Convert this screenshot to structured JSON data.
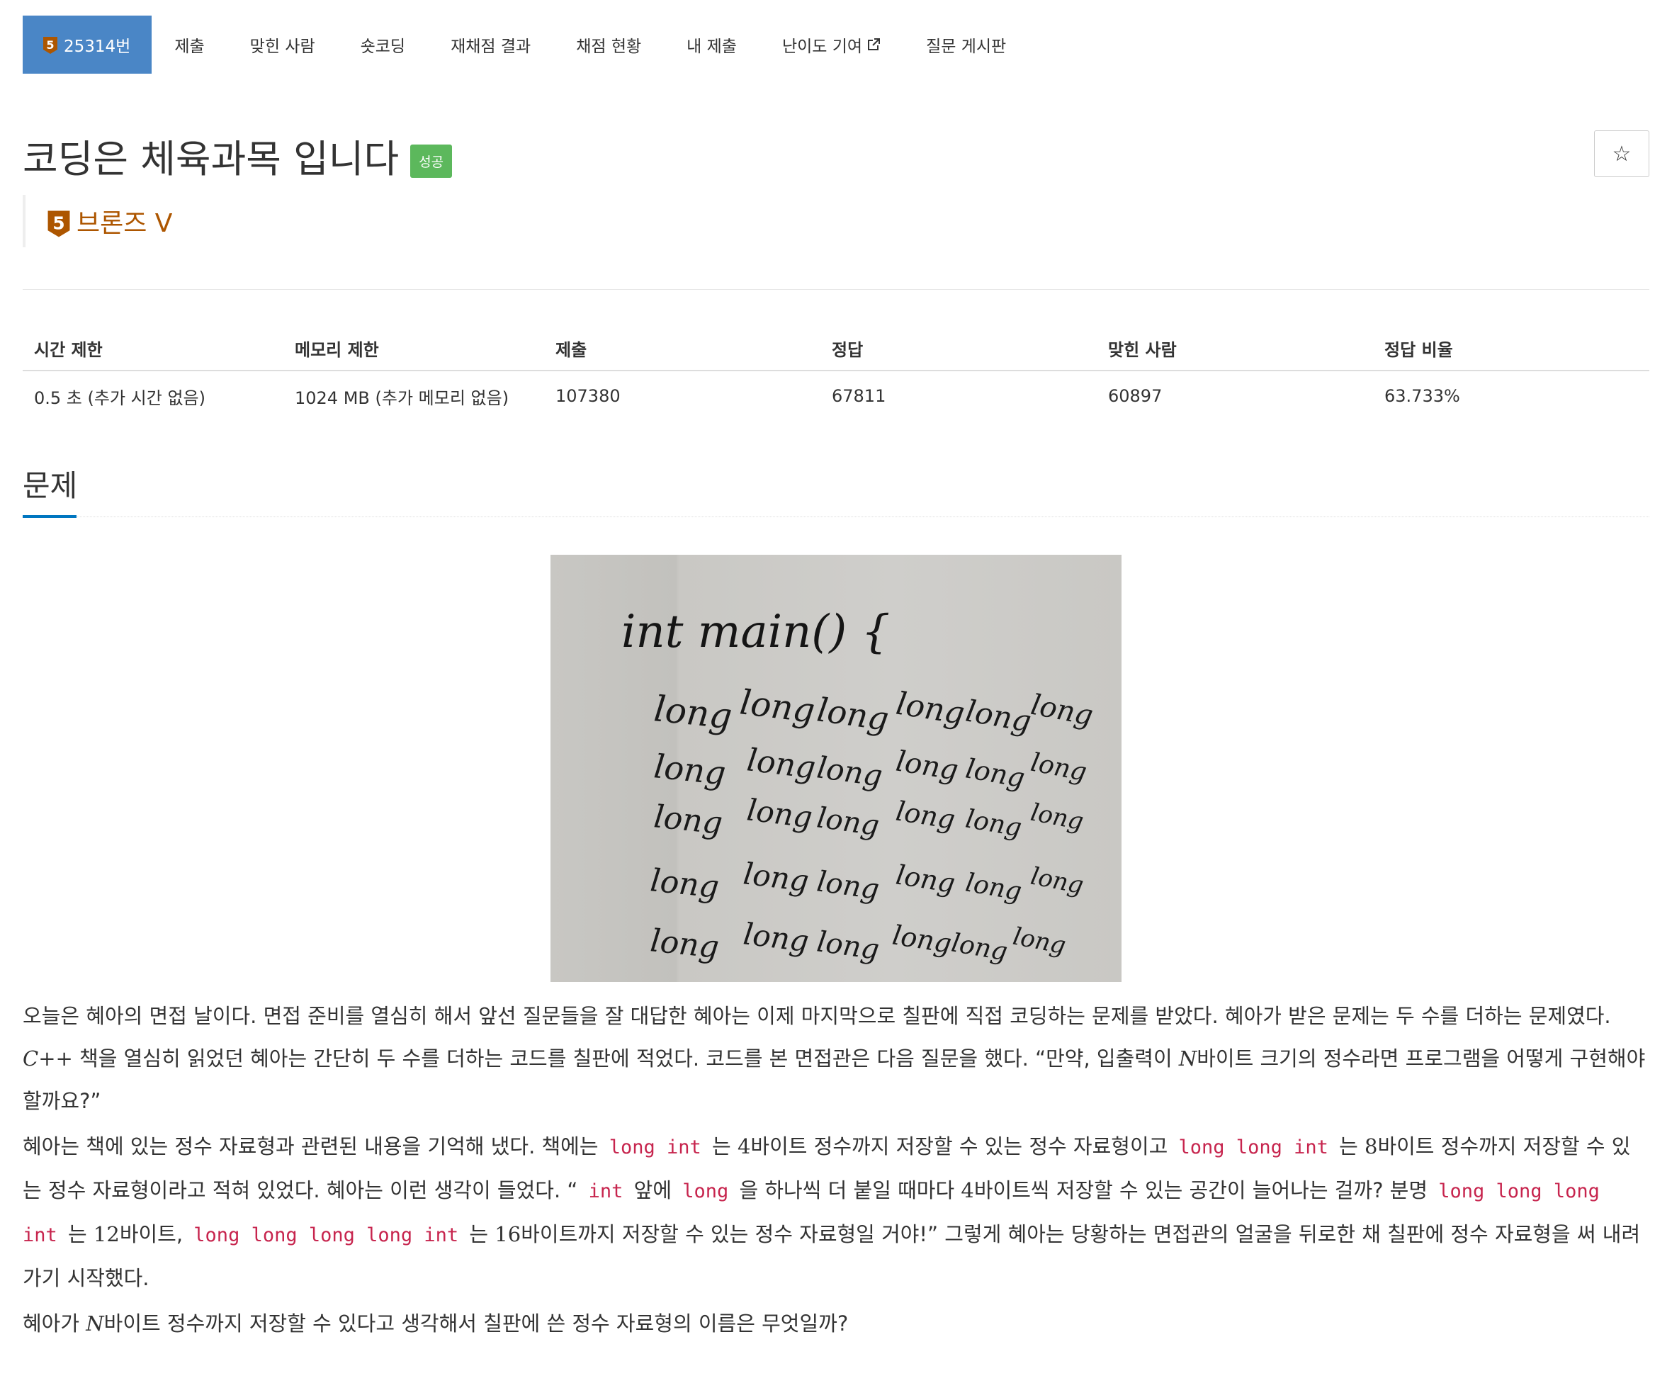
{
  "nav": {
    "problem_id": "25314번",
    "tabs": [
      "제출",
      "맞힌 사람",
      "숏코딩",
      "재채점 결과",
      "채점 현황",
      "내 제출",
      "난이도 기여",
      "질문 게시판"
    ]
  },
  "header": {
    "title": "코딩은 체육과목 입니다",
    "status_badge": "성공",
    "star_icon": "☆",
    "tier_digit": "5",
    "tier_label": "브론즈 V"
  },
  "stats": {
    "headers": [
      "시간 제한",
      "메모리 제한",
      "제출",
      "정답",
      "맞힌 사람",
      "정답 비율"
    ],
    "values": [
      "0.5 초 (추가 시간 없음)",
      "1024 MB (추가 메모리 없음)",
      "107380",
      "67811",
      "60897",
      "63.733%"
    ]
  },
  "section": {
    "title": "문제"
  },
  "board": {
    "line1": "int  main() {",
    "word": "long"
  },
  "problem": {
    "p1": {
      "a": "오늘은 혜아의 면접 날이다. 면접 준비를 열심히 해서 앞선 질문들을 잘 대답한 혜아는 이제 마지막으로 칠판에 직접 코딩하는 문제를 받았다. 혜아가 받은 문제는 두 수를 더하는 문제였다. ",
      "cpp": "C++",
      "b": " 책을 열심히 읽었던 혜아는 간단히 두 수를 더하는 코드를 칠판에 적었다. 코드를 본 면접관은 다음 질문을 했다. “만약, 입출력이 ",
      "n": "N",
      "c": "바이트 크기의 정수라면 프로그램을 어떻게 구현해야 할까요?”"
    },
    "p2": {
      "a": "혜아는 책에 있는 정수 자료형과 관련된 내용을 기억해 냈다. 책에는 ",
      "code1": "long int",
      "b": " 는 ",
      "n4": "4",
      "c": "바이트 정수까지 저장할 수 있는 정수 자료형이고 ",
      "code2": "long long int",
      "d": " 는 ",
      "n8": "8",
      "e": "바이트 정수까지 저장할 수 있는 정수 자료형이라고 적혀 있었다. 혜아는 이런 생각이 들었다. “ ",
      "code3": "int",
      "f": " 앞에 ",
      "code4": "long",
      "g": " 을 하나씩 더 붙일 때마다 ",
      "n4b": "4",
      "h": "바이트씩 저장할 수 있는 공간이 늘어나는 걸까? 분명 ",
      "code5": "long long long int",
      "i": " 는 ",
      "n12": "12",
      "j": "바이트, ",
      "code6": "long long long long int",
      "k": " 는 ",
      "n16": "16",
      "l": "바이트까지 저장할 수 있는 정수 자료형일 거야!” 그렇게 혜아는 당황하는 면접관의 얼굴을 뒤로한 채 칠판에 정수 자료형을 써 내려가기 시작했다."
    },
    "p3": {
      "a": "혜아가 ",
      "n": "N",
      "b": "바이트 정수까지 저장할 수 있다고 생각해서 칠판에 쓴 정수 자료형의 이름은 무엇일까?"
    }
  },
  "colors": {
    "active_tab": "#4a86c6",
    "success": "#5cb85c",
    "bronze": "#ad5600",
    "code": "#c7254e",
    "section_underline": "#0076c0"
  },
  "icons": {
    "tier_icon": "bronze-5-tier-icon",
    "external_link_icon": "external-link-icon",
    "star_icon": "star-outline-icon"
  }
}
